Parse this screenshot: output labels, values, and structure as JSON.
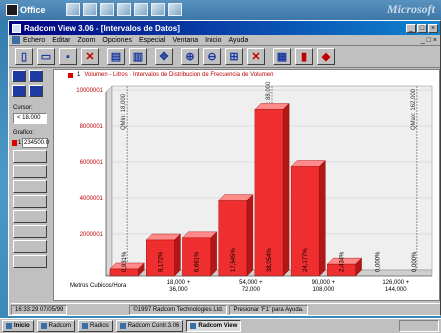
{
  "office_bar": {
    "label": "Office",
    "right_text": "Microsoft"
  },
  "window": {
    "title": "Radcom View 3.06 - [Intervalos de Datos]",
    "menu": [
      "Echero",
      "Editar",
      "Zoom",
      "Opciones",
      "Especial",
      "Ventana",
      "Inicio",
      "Ayuda"
    ],
    "toolbar_icons": [
      "new-document-icon",
      "open-folder-icon",
      "save-icon",
      "delete-icon",
      "print-icon",
      "print-preview-icon",
      "move-icon",
      "zoom-in-icon",
      "zoom-out-icon",
      "zoom-fit-icon",
      "zoom-reset-icon",
      "chart-icon",
      "bar-chart-icon",
      "book-icon"
    ]
  },
  "left_panel": {
    "cursor_label": "Cursor:",
    "cursor_value": "< 18.000",
    "graphs_label": "Grafico:",
    "graph_number": "1",
    "graph_value": "234500.0",
    "graph_color": "#e00000"
  },
  "legend": {
    "number": "1",
    "text": "Volumen - Litros · Intervalos de Distribucion de Frecuencia de Volumen"
  },
  "chart_data": {
    "type": "bar",
    "y_tick_labels": [
      "10000001",
      "8000001",
      "6000001",
      "4000001",
      "2000001"
    ],
    "ylim": [
      0,
      10000001
    ],
    "x_tick_labels": [
      "18,000 +\n36,000",
      "54,000 +\n72,000",
      "90,000 +\n108,000",
      "126,000 +\n144,000"
    ],
    "xlabel": "Metros Cubicos/Hora",
    "values": [
      390000,
      2000000,
      2120000,
      4190000,
      9250000,
      6080000,
      660000,
      0,
      0
    ],
    "value_labels": [
      "0,931%",
      "8,172%",
      "6,661%",
      "17,545%",
      "38,054%",
      "24,177%",
      "2,434%",
      "0,000%",
      "0,000%"
    ],
    "markers": [
      {
        "label": "QMin: 18,000",
        "index": 0
      },
      {
        "label": "QNominal: 88,000",
        "index": 4
      },
      {
        "label": "QMax: 162,000",
        "index": 8
      }
    ],
    "bar_color": "#ef2f2f"
  },
  "status": {
    "time": "16:33:29  07/05/99",
    "copyright": "©1997 Radcom Technologies Ltd.",
    "hint": "Presionar 'F1' para Ayuda."
  },
  "taskbar": {
    "start": "Inicio",
    "tasks": [
      "Radcom",
      "Radios",
      "Radcom Contr.3.06",
      "Radcom View"
    ]
  }
}
